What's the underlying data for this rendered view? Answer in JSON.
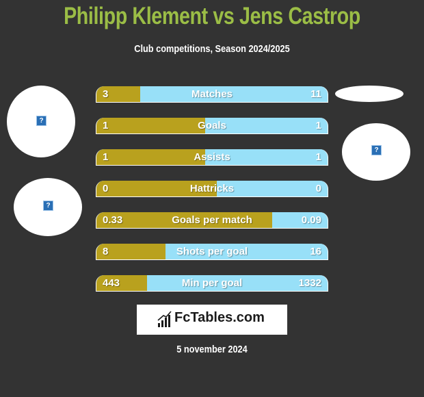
{
  "header": {
    "title": "Philipp Klement vs Jens Castrop",
    "subtitle": "Club competitions, Season 2024/2025"
  },
  "colors": {
    "left": "#b9a11e",
    "right": "#98e0f8",
    "title": "#9bbd46",
    "background": "#333333"
  },
  "stats": [
    {
      "label": "Matches",
      "left": "3",
      "right": "11",
      "left_share": 0.19
    },
    {
      "label": "Goals",
      "left": "1",
      "right": "1",
      "left_share": 0.47
    },
    {
      "label": "Assists",
      "left": "1",
      "right": "1",
      "left_share": 0.47
    },
    {
      "label": "Hattricks",
      "left": "0",
      "right": "0",
      "left_share": 0.52
    },
    {
      "label": "Goals per match",
      "left": "0.33",
      "right": "0.09",
      "left_share": 0.76
    },
    {
      "label": "Shots per goal",
      "left": "8",
      "right": "16",
      "left_share": 0.3
    },
    {
      "label": "Min per goal",
      "left": "443",
      "right": "1332",
      "left_share": 0.22
    }
  ],
  "avatars": {
    "placeholder_glyph": "?"
  },
  "footer": {
    "brand": "FcTables.com",
    "date": "5 november 2024"
  }
}
